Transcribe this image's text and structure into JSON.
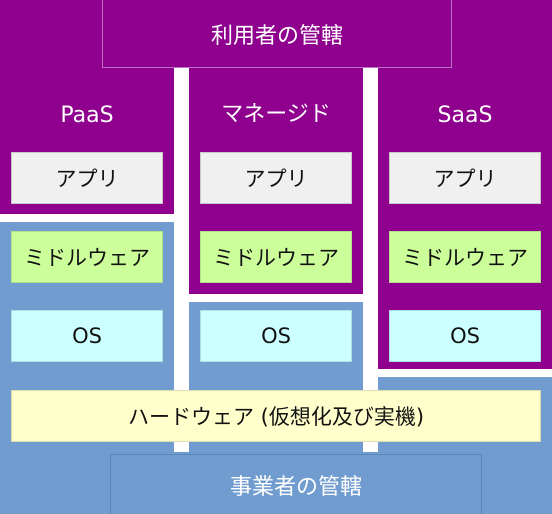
{
  "user_managed_label": "利用者の管轄",
  "provider_managed_label": "事業者の管轄",
  "hardware_label": "ハードウェア (仮想化及び実機)",
  "columns": [
    {
      "title": "PaaS",
      "app": "アプリ",
      "middleware": "ミドルウェア",
      "os": "OS"
    },
    {
      "title": "マネージド",
      "app": "アプリ",
      "middleware": "ミドルウェア",
      "os": "OS"
    },
    {
      "title": "SaaS",
      "app": "アプリ",
      "middleware": "ミドルウェア",
      "os": "OS"
    }
  ],
  "colors": {
    "user_managed": "#8f008f",
    "provider_managed": "#709ccf",
    "app": "#f0f0f0",
    "middleware": "#ccff99",
    "os": "#ccffff",
    "hardware": "#ffffcc"
  }
}
